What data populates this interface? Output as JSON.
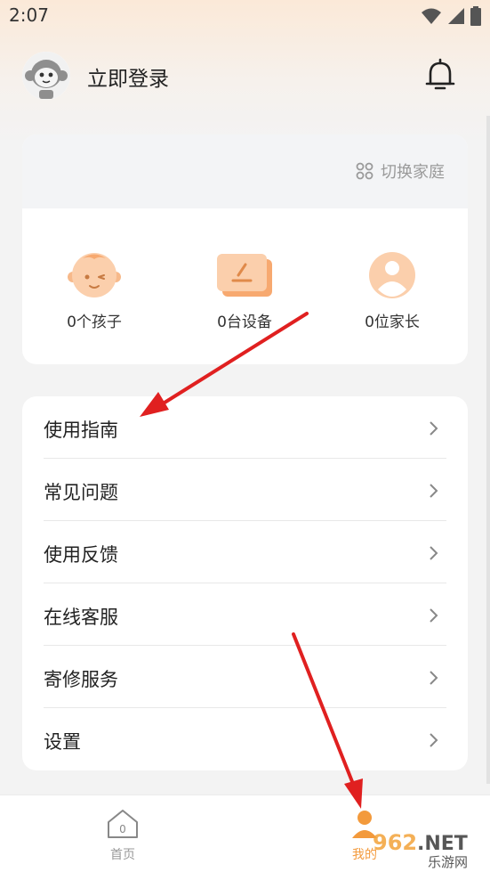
{
  "status_bar": {
    "time": "2:07"
  },
  "header": {
    "login_label": "立即登录"
  },
  "family_card": {
    "switch_label": "切换家庭",
    "stats": [
      {
        "label": "0个孩子"
      },
      {
        "label": "0台设备"
      },
      {
        "label": "0位家长"
      }
    ]
  },
  "menu": {
    "items": [
      {
        "label": "使用指南"
      },
      {
        "label": "常见问题"
      },
      {
        "label": "使用反馈"
      },
      {
        "label": "在线客服"
      },
      {
        "label": "寄修服务"
      },
      {
        "label": "设置"
      }
    ]
  },
  "bottom_nav": {
    "home_label": "首页",
    "home_icon_digit": "0",
    "mine_label": "我的"
  },
  "watermark": {
    "number": "962",
    "suffix": ".NET",
    "sub": "乐游网"
  },
  "colors": {
    "accent_orange": "#f39a3c",
    "arrow_red": "#e02020",
    "text_gray": "#9a9a9a"
  }
}
